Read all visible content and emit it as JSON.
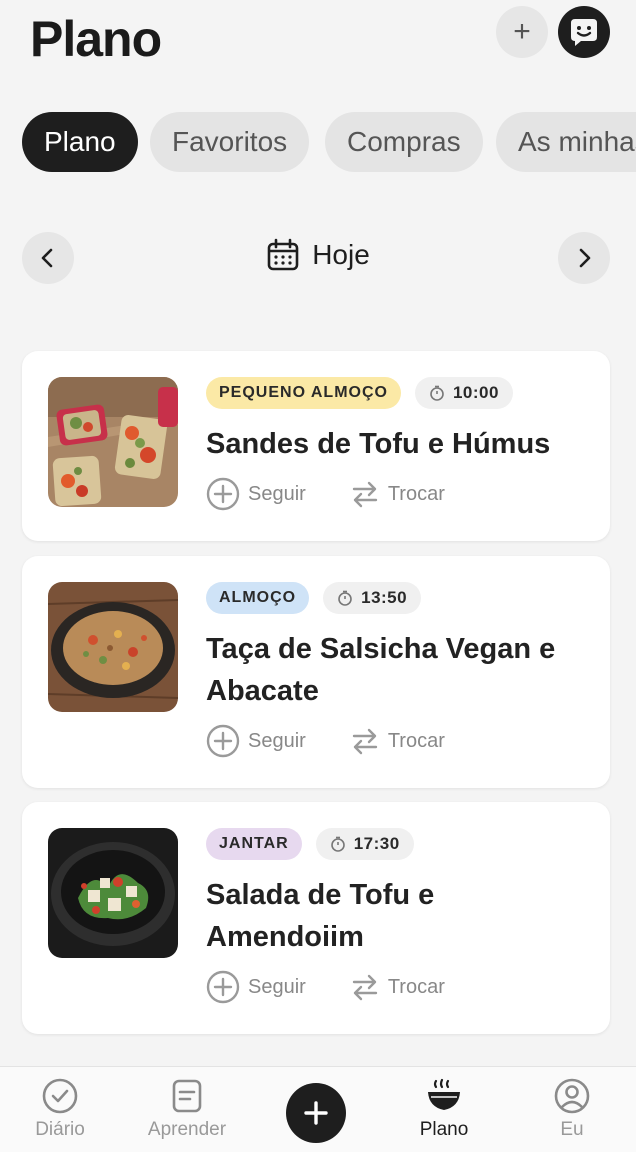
{
  "header": {
    "title": "Plano",
    "add_label": "+"
  },
  "tabs": [
    {
      "label": "Plano",
      "active": true
    },
    {
      "label": "Favoritos",
      "active": false
    },
    {
      "label": "Compras",
      "active": false
    },
    {
      "label": "As minhas receitas",
      "active": false
    }
  ],
  "date": {
    "label": "Hoje"
  },
  "meals": [
    {
      "category": "PEQUENO ALMOÇO",
      "category_color": "#fbe9a6",
      "time": "10:00",
      "title": "Sandes de Tofu e Húmus",
      "follow": "Seguir",
      "swap": "Trocar"
    },
    {
      "category": "ALMOÇO",
      "category_color": "#cfe3f7",
      "time": "13:50",
      "title": "Taça de Salsicha Vegan e Abacate",
      "follow": "Seguir",
      "swap": "Trocar"
    },
    {
      "category": "JANTAR",
      "category_color": "#e7d9ef",
      "time": "17:30",
      "title": "Salada de Tofu e Amendoiim",
      "follow": "Seguir",
      "swap": "Trocar"
    }
  ],
  "bottom_nav": [
    {
      "label": "Diário",
      "icon": "check-circle-icon"
    },
    {
      "label": "Aprender",
      "icon": "document-icon"
    },
    {
      "label": "Plano",
      "icon": "bowl-icon",
      "active": true
    },
    {
      "label": "Eu",
      "icon": "user-circle-icon"
    }
  ],
  "colors": {
    "accent": "#1e1e1e",
    "background": "#f4f4f4"
  }
}
